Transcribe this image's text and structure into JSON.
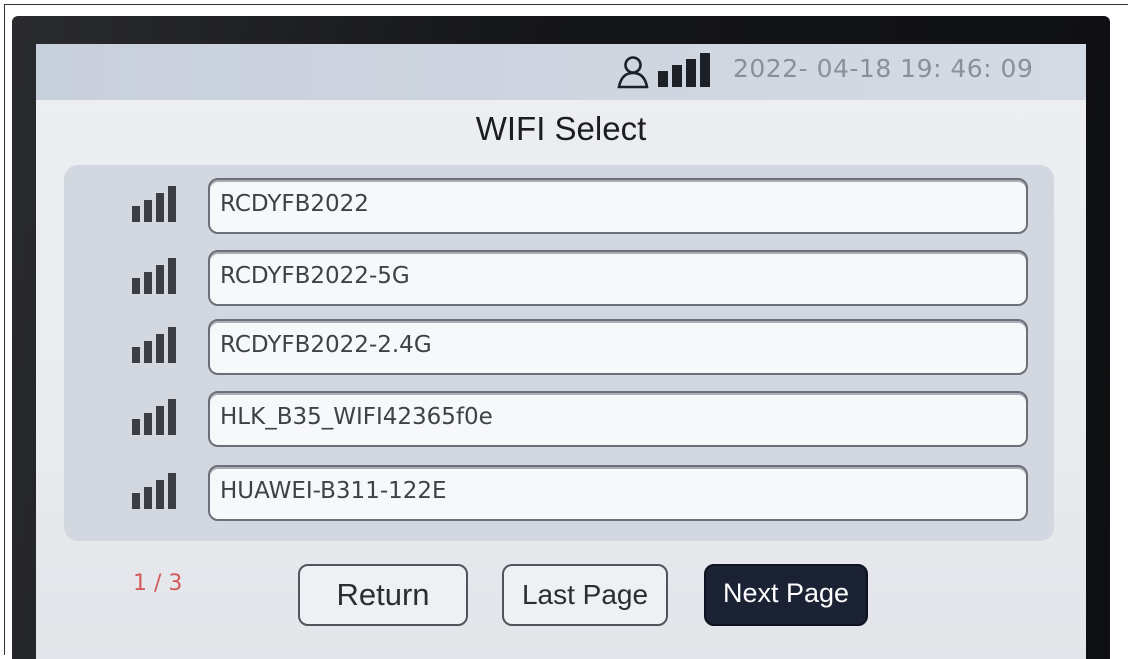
{
  "status_bar": {
    "datetime": "2022- 04-18 19: 46: 09",
    "icons": [
      "user-icon",
      "signal-strength-icon"
    ]
  },
  "title": "WIFI Select",
  "networks": [
    {
      "ssid": "RCDYFB2022",
      "icon": "wifi-signal-icon"
    },
    {
      "ssid": "RCDYFB2022-5G",
      "icon": "wifi-signal-icon"
    },
    {
      "ssid": "RCDYFB2022-2.4G",
      "icon": "wifi-signal-icon"
    },
    {
      "ssid": "HLK_B35_WIFI42365f0e",
      "icon": "wifi-signal-icon"
    },
    {
      "ssid": "HUAWEI-B311-122E",
      "icon": "wifi-signal-icon"
    }
  ],
  "pagination": {
    "text": "1 / 3",
    "current": 1,
    "total": 3
  },
  "buttons": {
    "return_label": "Return",
    "last_page_label": "Last Page",
    "next_page_label": "Next Page"
  },
  "colors": {
    "status_bar": "#cdd4df",
    "screen_bg": "#eceef2",
    "list_panel": "#d3d8e0",
    "active_button": "#1b2234",
    "pager_text": "#d25a5a"
  }
}
